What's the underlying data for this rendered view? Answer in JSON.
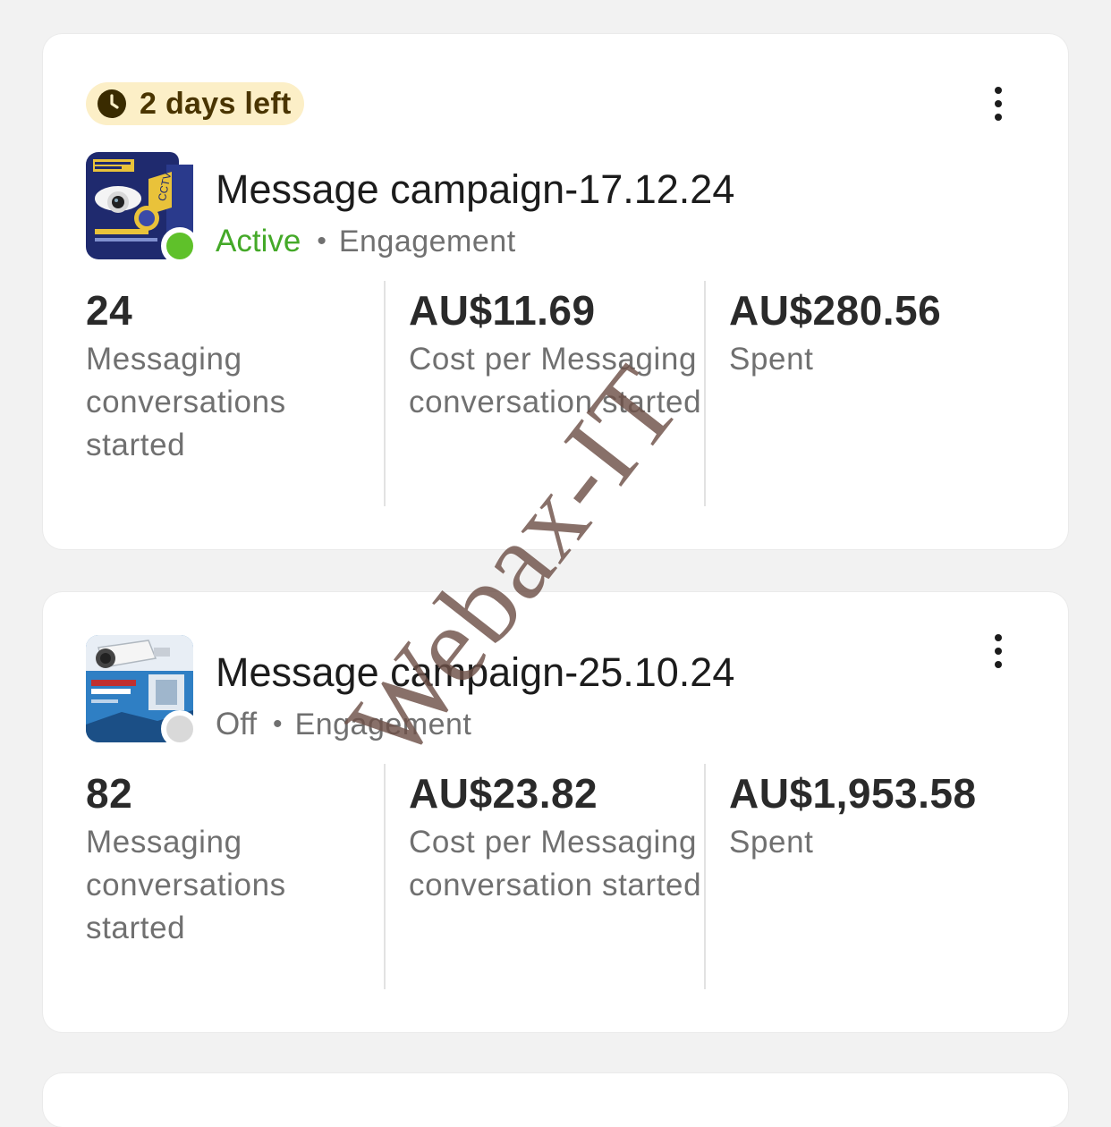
{
  "campaigns": [
    {
      "badge": {
        "text": "2 days left",
        "icon": "clock-icon",
        "background": "#fcefc7",
        "text_color": "#4a3500"
      },
      "name": "Message campaign-17.12.24",
      "status": "Active",
      "status_color": "#44a928",
      "status_dot_color": "#5fc12a",
      "separator": "•",
      "objective": "Engagement",
      "thumbnail": "cctv-camera-ad-thumbnail",
      "metrics": [
        {
          "value": "24",
          "label": "Messaging conversations started"
        },
        {
          "value": "AU$11.69",
          "label": "Cost per Messaging conversation started"
        },
        {
          "value": "AU$280.56",
          "label": "Spent"
        }
      ]
    },
    {
      "name": "Message campaign-25.10.24",
      "status": "Off",
      "status_color": "#707070",
      "status_dot_color": "#d9d9d9",
      "separator": "•",
      "objective": "Engagement",
      "thumbnail": "security-camera-ad-thumbnail",
      "metrics": [
        {
          "value": "82",
          "label": "Messaging conversations started"
        },
        {
          "value": "AU$23.82",
          "label": "Cost per Messaging conversation started"
        },
        {
          "value": "AU$1,953.58",
          "label": "Spent"
        }
      ]
    }
  ],
  "watermark": "Webax-IT",
  "colors": {
    "page_background": "#f2f2f2",
    "card_background": "#ffffff",
    "primary_text": "#1c1c1c",
    "secondary_text": "#707070",
    "divider": "#e2e2e2"
  }
}
